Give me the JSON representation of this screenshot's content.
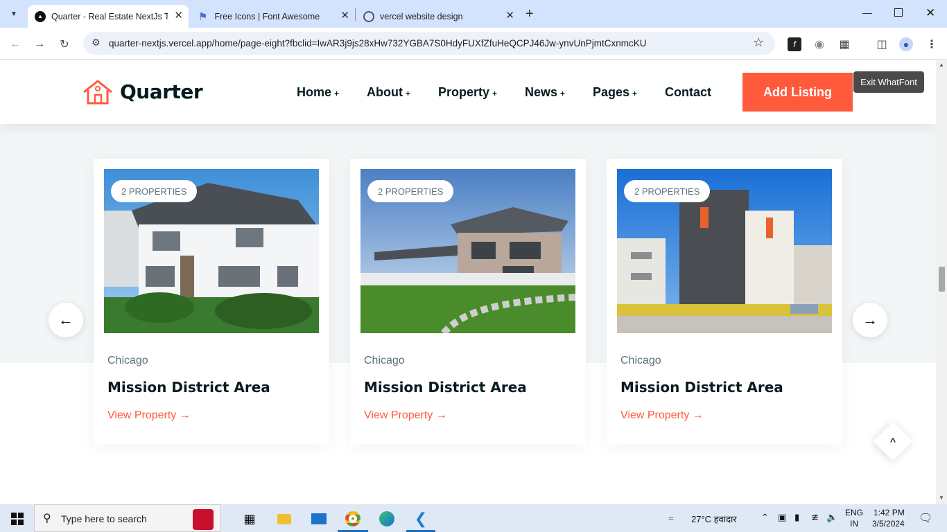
{
  "browser": {
    "tabs": [
      {
        "title": "Quarter - Real Estate NextJs Ten"
      },
      {
        "title": "Free Icons | Font Awesome"
      },
      {
        "title": "vercel website design"
      }
    ],
    "url": "quarter-nextjs.vercel.app/home/page-eight?fbclid=IwAR3j9js28xHw732YGBA7S0HdyFUXfZfuHeQCPJ46Jw-ynvUnPjmtCxnmcKU"
  },
  "site": {
    "brand": "Quarter",
    "nav": [
      {
        "label": "Home",
        "plus": "+"
      },
      {
        "label": "About",
        "plus": "+"
      },
      {
        "label": "Property",
        "plus": "+"
      },
      {
        "label": "News",
        "plus": "+"
      },
      {
        "label": "Pages",
        "plus": "+"
      },
      {
        "label": "Contact",
        "plus": ""
      }
    ],
    "cta": "Add Listing",
    "whatfont": "Exit WhatFont",
    "accent": "#ff5a3c",
    "dark": "#071c1f"
  },
  "cards": [
    {
      "badge": "2 PROPERTIES",
      "city": "Chicago",
      "title": "Mission District Area",
      "link": "View Property →"
    },
    {
      "badge": "2 PROPERTIES",
      "city": "Chicago",
      "title": "Mission District Area",
      "link": "View Property →"
    },
    {
      "badge": "2 PROPERTIES",
      "city": "Chicago",
      "title": "Mission District Area",
      "link": "View Property →"
    }
  ],
  "taskbar": {
    "search_placeholder": "Type here to search",
    "weather": "27°C  हवादार",
    "lang": "ENG",
    "region": "IN",
    "time": "1:42 PM",
    "date": "3/5/2024"
  }
}
